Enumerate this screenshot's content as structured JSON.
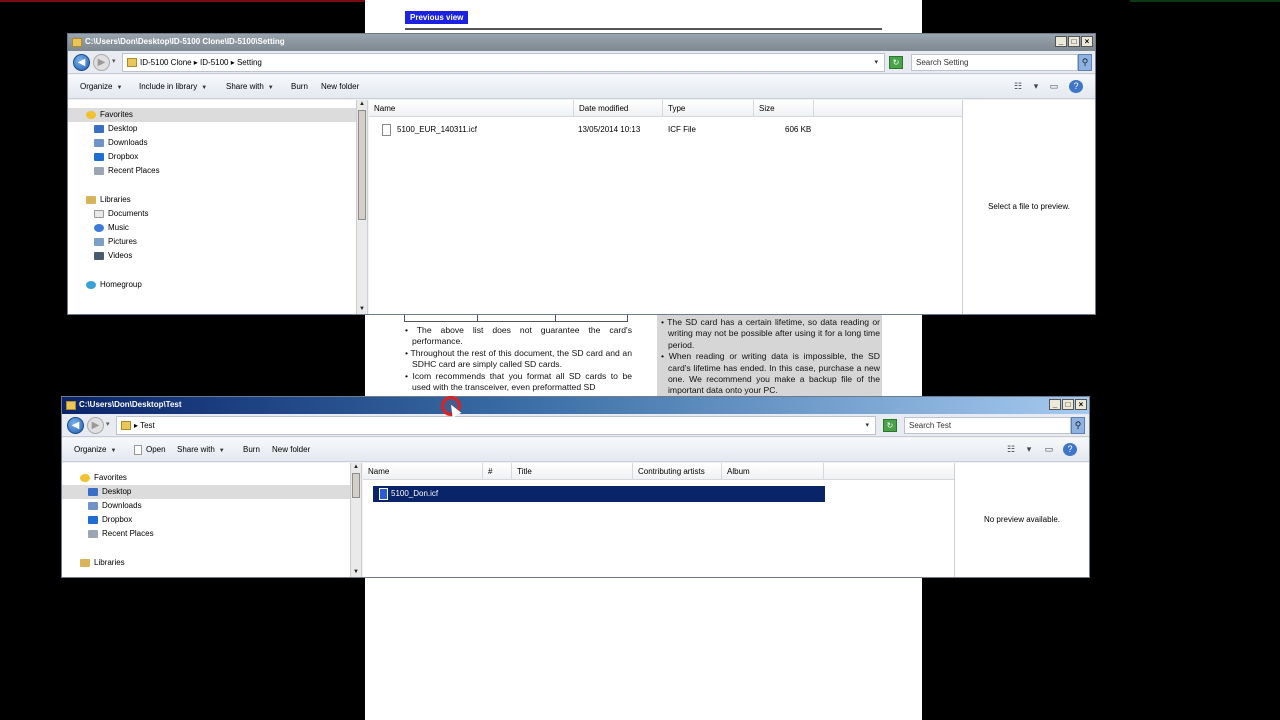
{
  "pdf": {
    "prev_view_label": "Previous view",
    "left_col": [
      "• The above list does not guarantee the card's performance.",
      "• Throughout the rest of this document, the SD card and an SDHC card are simply called SD cards.",
      "• Icom recommends that you format all SD cards to be used with the transceiver, even preformatted SD"
    ],
    "right_col": [
      "• The SD card has a certain lifetime, so data reading or writing may not be possible after using it for a long time period.",
      "• When reading or writing data is impossible, the SD card's lifetime has ended. In this case, purchase a new one. We recommend you make a backup file of the important data onto your PC."
    ]
  },
  "win1": {
    "title": "C:\\Users\\Don\\Desktop\\ID-5100 Clone\\ID-5100\\Setting",
    "address": "ID-5100 Clone  ▸  ID-5100  ▸  Setting",
    "search_placeholder": "Search Setting",
    "toolbar": {
      "organize": "Organize",
      "include": "Include in library",
      "share": "Share with",
      "burn": "Burn",
      "new_folder": "New folder"
    },
    "nav": {
      "favorites": "Favorites",
      "desktop": "Desktop",
      "downloads": "Downloads",
      "dropbox": "Dropbox",
      "recent": "Recent Places",
      "libraries": "Libraries",
      "documents": "Documents",
      "music": "Music",
      "pictures": "Pictures",
      "videos": "Videos",
      "homegroup": "Homegroup"
    },
    "columns": {
      "name": "Name",
      "date": "Date modified",
      "type": "Type",
      "size": "Size"
    },
    "files": [
      {
        "name": "5100_EUR_140311.icf",
        "date": "13/05/2014 10:13",
        "type": "ICF File",
        "size": "606 KB"
      }
    ],
    "preview_text": "Select a file to preview."
  },
  "win2": {
    "title": "C:\\Users\\Don\\Desktop\\Test",
    "address": "▸  Test",
    "search_placeholder": "Search Test",
    "toolbar": {
      "organize": "Organize",
      "open": "Open",
      "share": "Share with",
      "burn": "Burn",
      "new_folder": "New folder"
    },
    "nav": {
      "favorites": "Favorites",
      "desktop": "Desktop",
      "downloads": "Downloads",
      "dropbox": "Dropbox",
      "recent": "Recent Places",
      "libraries": "Libraries"
    },
    "columns": {
      "name": "Name",
      "num": "#",
      "title": "Title",
      "artists": "Contributing artists",
      "album": "Album"
    },
    "files": [
      {
        "name": "5100_Don.icf"
      }
    ],
    "preview_text": "No preview available."
  },
  "colors": {
    "selection": "#0a246a",
    "active_title": "#0a246a",
    "prev_view": "#1d22e0"
  }
}
